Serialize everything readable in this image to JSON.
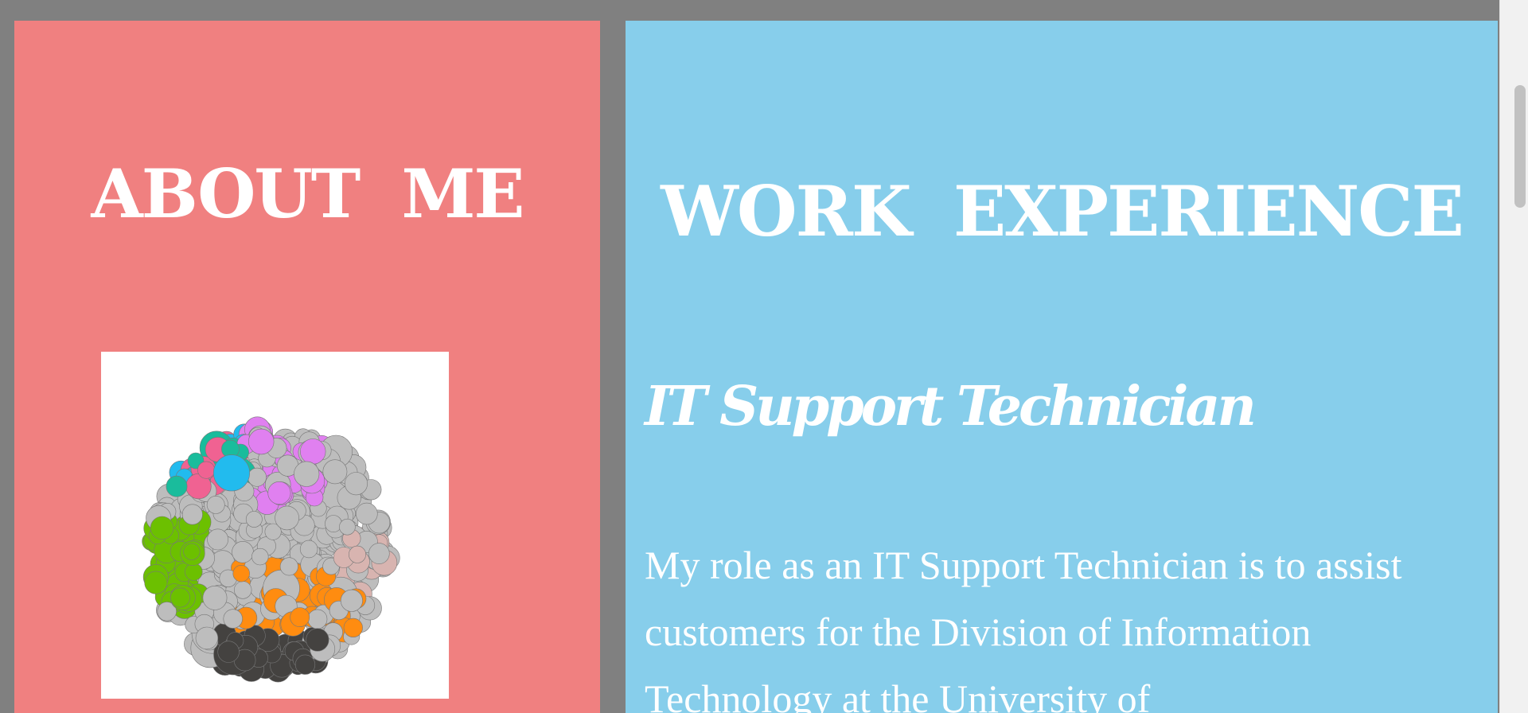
{
  "about": {
    "title": "ABOUT ME",
    "photo": {
      "icon": "bubble-network-image"
    }
  },
  "work": {
    "title": "WORK EXPERIENCE",
    "job_title": "IT Support Technician",
    "job_description": "My role as an IT Support Technician is to assist customers for the Division of Information Technology at the University of"
  },
  "colors": {
    "about_bg": "#f08080",
    "work_bg": "#87ceeb",
    "page_bg": "#808080",
    "text": "#ffffff"
  }
}
